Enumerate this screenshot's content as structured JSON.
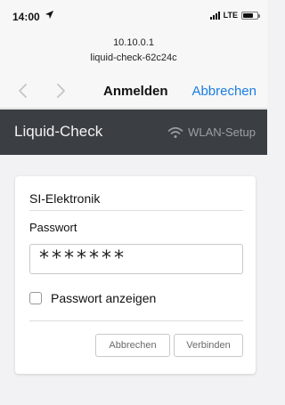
{
  "status_bar": {
    "time": "14:00",
    "network": "LTE",
    "icons": [
      "location-arrow-icon",
      "signal-bars-icon",
      "battery-icon"
    ]
  },
  "url_bar": {
    "host": "10.10.0.1",
    "title": "liquid-check-62c24c"
  },
  "nav": {
    "title": "Anmelden",
    "cancel_label": "Abbrechen",
    "accent_color": "#1a7de0",
    "icons": [
      "back-chevron-icon",
      "forward-chevron-icon"
    ]
  },
  "app_bar": {
    "brand": "Liquid-Check",
    "wlan_label": "WLAN-Setup",
    "background": "#3b3f43",
    "icons": [
      "wifi-icon"
    ]
  },
  "form": {
    "network_name": "SI-Elektronik",
    "password_label": "Passwort",
    "password_value": "*******",
    "show_password_label": "Passwort anzeigen",
    "show_password_checked": false,
    "cancel_label": "Abbrechen",
    "connect_label": "Verbinden"
  }
}
